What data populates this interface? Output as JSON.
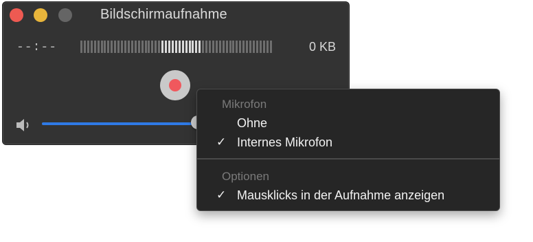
{
  "window": {
    "title": "Bildschirmaufnahme",
    "time_display": "--:--",
    "file_size": "0 KB",
    "volume_level": 0.63,
    "colors": {
      "close": "#ee5a52",
      "minimize": "#e8b53b",
      "zoom": "#656565",
      "record_dot": "#f0585d",
      "volume_fill": "#2f7ae5"
    },
    "icons": {
      "record": "record-icon",
      "volume": "speaker-icon"
    }
  },
  "menu": {
    "sections": [
      {
        "header": "Mikrofon",
        "items": [
          {
            "label": "Ohne",
            "checked": false
          },
          {
            "label": "Internes Mikrofon",
            "checked": true
          }
        ]
      },
      {
        "header": "Optionen",
        "items": [
          {
            "label": "Mausklicks in der Aufnahme anzeigen",
            "checked": true
          }
        ]
      }
    ],
    "check_glyph": "✓"
  }
}
